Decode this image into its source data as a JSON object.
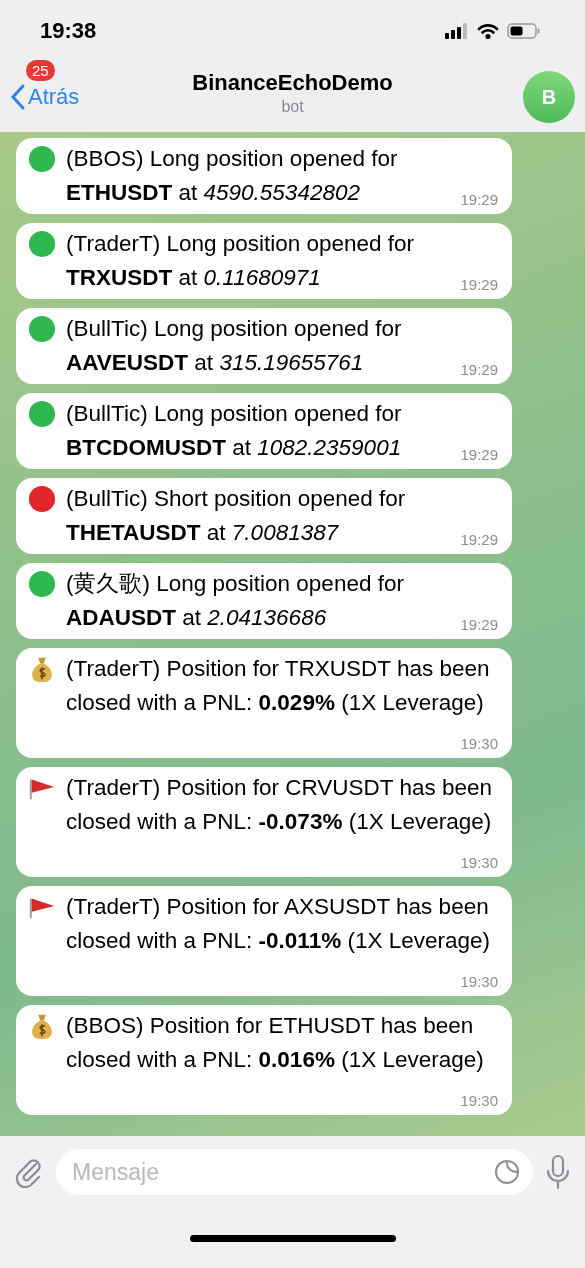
{
  "status_bar": {
    "time": "19:38"
  },
  "header": {
    "back_label": "Atrás",
    "unread_badge": "25",
    "title": "BinanceEchoDemo",
    "subtitle": "bot",
    "avatar_letter": "B"
  },
  "messages": [
    {
      "kind": "long",
      "text": "(BBOS) Long position opened for **ETHUSDT** at *4590.55342802*",
      "time": "19:29"
    },
    {
      "kind": "long",
      "text": "(TraderT) Long position opened for **TRXUSDT** at *0.11680971*",
      "time": "19:29"
    },
    {
      "kind": "long",
      "text": "(BullTic) Long position opened for **AAVEUSDT** at *315.19655761*",
      "time": "19:29"
    },
    {
      "kind": "long",
      "text": "(BullTic) Long position opened for **BTCDOMUSDT** at *1082.2359001*",
      "time": "19:29"
    },
    {
      "kind": "short",
      "text": "(BullTic) Short position opened for **THETAUSDT** at *7.0081387*",
      "time": "19:29"
    },
    {
      "kind": "long",
      "text": "(黄久歌) Long position opened for **ADAUSDT** at *2.04136686*",
      "time": "19:29"
    },
    {
      "kind": "profit",
      "text": "(TraderT) Position for TRXUSDT has been closed with a PNL: **0.029%** (1X Leverage)",
      "time": "19:30"
    },
    {
      "kind": "loss",
      "text": "(TraderT) Position for CRVUSDT has been closed with a PNL: **-0.073%** (1X Leverage)",
      "time": "19:30"
    },
    {
      "kind": "loss",
      "text": "(TraderT) Position for AXSUSDT has been closed with a PNL: **-0.011%** (1X Leverage)",
      "time": "19:30"
    },
    {
      "kind": "profit",
      "text": "(BBOS) Position for ETHUSDT has been closed with a PNL: **0.016%** (1X Leverage)",
      "time": "19:30"
    }
  ],
  "composer": {
    "placeholder": "Mensaje"
  }
}
